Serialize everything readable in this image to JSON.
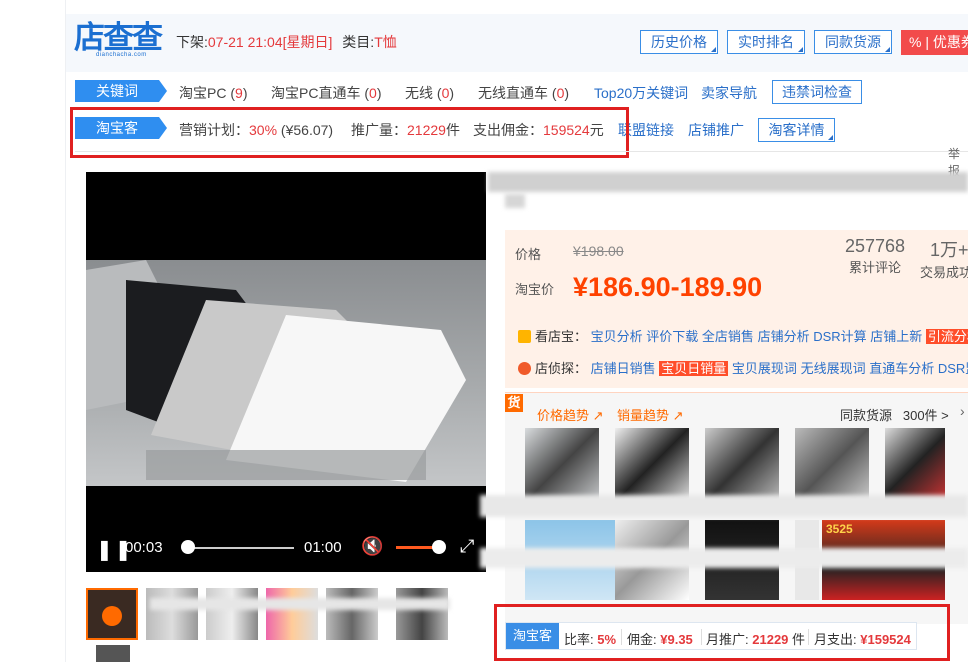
{
  "logo": {
    "main": "店查查",
    "sub": "dianchacha.com"
  },
  "shelf": {
    "label": "下架:",
    "time": "07-21 21:04",
    "weekday": "[星期日]",
    "category_label": "类目:",
    "category": "T恤"
  },
  "top_buttons": [
    "历史价格",
    "实时排名",
    "同款货源"
  ],
  "discount_label": "% | 优惠券",
  "keyword_row": {
    "tag": "关键词",
    "items": [
      {
        "label": "淘宝PC",
        "count": "9"
      },
      {
        "label": "淘宝PC直通车",
        "count": "0"
      },
      {
        "label": "无线",
        "count": "0"
      },
      {
        "label": "无线直通车",
        "count": "0"
      }
    ],
    "links": [
      "Top20万关键词",
      "卖家导航"
    ],
    "button": "违禁词检查"
  },
  "taobaoke_row": {
    "tag": "淘宝客",
    "plan_label": "营销计划：",
    "plan_rate": "30%",
    "plan_amount": "(¥56.07)",
    "promo_label": "推广量：",
    "promo_value": "21229",
    "promo_unit": "件",
    "spend_label": "支出佣金：",
    "spend_value": "159524",
    "spend_unit": "元",
    "links": [
      "联盟链接",
      "店铺推广"
    ],
    "button": "淘客详情"
  },
  "report_label": "举报",
  "video": {
    "current_time": "00:03",
    "duration": "01:00",
    "progress": 0.05,
    "volume": 0.85
  },
  "price": {
    "price_label": "价格",
    "original": "¥198.00",
    "taobao_label": "淘宝价",
    "current": "¥186.90-189.90",
    "reviews_value": "257768",
    "reviews_label": "累计评论",
    "deals_value": "1万+",
    "deals_label": "交易成功"
  },
  "kandian": {
    "label": "看店宝：",
    "links": [
      "宝贝分析",
      "评价下载",
      "全店销售",
      "店铺分析",
      "DSR计算",
      "店铺上新"
    ],
    "hot": "引流分析"
  },
  "dianzhen": {
    "label": "店侦探：",
    "first": "店铺日销售",
    "hot": "宝贝日销量",
    "links": [
      "宝贝展现词",
      "无线展现词",
      "直通车分析",
      "DSR监控"
    ]
  },
  "source": {
    "badge": "货",
    "price_trend": "价格趋势",
    "sales_trend": "销量趋势",
    "same_label": "同款货源",
    "same_count": "300件 >",
    "thumb_badge": "3525"
  },
  "bottom_bar": {
    "tag": "淘宝客",
    "rate_label": "比率:",
    "rate": "5%",
    "commission_label": "佣金:",
    "commission": "¥9.35",
    "monthly_promo_label": "月推广:",
    "monthly_promo": "21229",
    "monthly_promo_unit": "件",
    "monthly_spend_label": "月支出:",
    "monthly_spend": "¥159524"
  },
  "colors": {
    "brand_blue": "#2f8ef0",
    "accent_red": "#e4393c",
    "price_orange": "#ff4200",
    "highlight_box": "#e02020"
  }
}
